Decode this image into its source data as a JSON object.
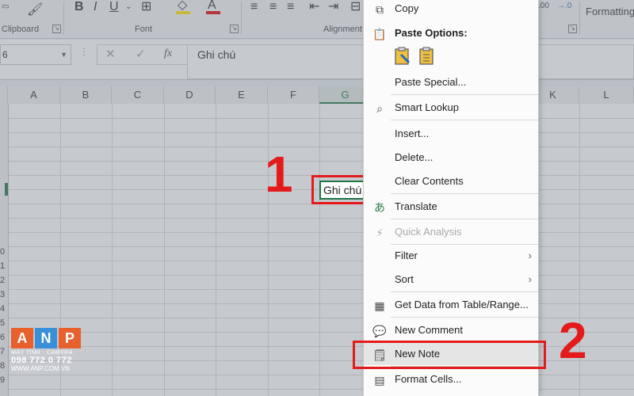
{
  "ribbon": {
    "groups": {
      "clipboard": "Clipboard",
      "font": "Font",
      "alignment": "Alignment",
      "formatting": "Formatting"
    },
    "number_format_fragments": [
      ".00",
      "→.0"
    ],
    "font_colors": {
      "highlight": "#ffe000",
      "text": "#e00000"
    }
  },
  "formula_bar": {
    "name_box": "6",
    "cancel_icon": "✕",
    "enter_icon": "✓",
    "fx_label": "fx",
    "content": "Ghi chú"
  },
  "columns": [
    "A",
    "B",
    "C",
    "D",
    "E",
    "F",
    "G",
    "K",
    "L"
  ],
  "rows": [
    "0",
    "1",
    "2",
    "3",
    "4",
    "5",
    "6",
    "7",
    "8",
    "9"
  ],
  "active_cell": {
    "text": "Ghi chú"
  },
  "steps": {
    "one": "1",
    "two": "2"
  },
  "context_menu": {
    "items": [
      {
        "label": "Copy",
        "icon": "copy-icon"
      },
      {
        "label": "Paste Options:",
        "icon": "paste-icon"
      },
      {
        "label": "Paste Special...",
        "icon": ""
      },
      {
        "label": "Smart Lookup",
        "icon": "search-icon"
      },
      {
        "label": "Insert...",
        "icon": ""
      },
      {
        "label": "Delete...",
        "icon": ""
      },
      {
        "label": "Clear Contents",
        "icon": ""
      },
      {
        "label": "Translate",
        "icon": "translate-icon"
      },
      {
        "label": "Quick Analysis",
        "icon": "quick-analysis-icon"
      },
      {
        "label": "Filter",
        "icon": ""
      },
      {
        "label": "Sort",
        "icon": ""
      },
      {
        "label": "Get Data from Table/Range...",
        "icon": "table-icon"
      },
      {
        "label": "New Comment",
        "icon": "comment-icon"
      },
      {
        "label": "New Note",
        "icon": "note-icon"
      },
      {
        "label": "Format Cells...",
        "icon": "format-cells-icon"
      }
    ]
  },
  "watermark": {
    "letters": [
      "A",
      "N",
      "P"
    ],
    "tagline": "MÁY TÍNH · CAMERA",
    "phone": "098 772 0 772",
    "site": "WWW.ANP.COM.VN",
    "colors": [
      "#e8602c",
      "#3a8fd9",
      "#e8602c"
    ]
  }
}
